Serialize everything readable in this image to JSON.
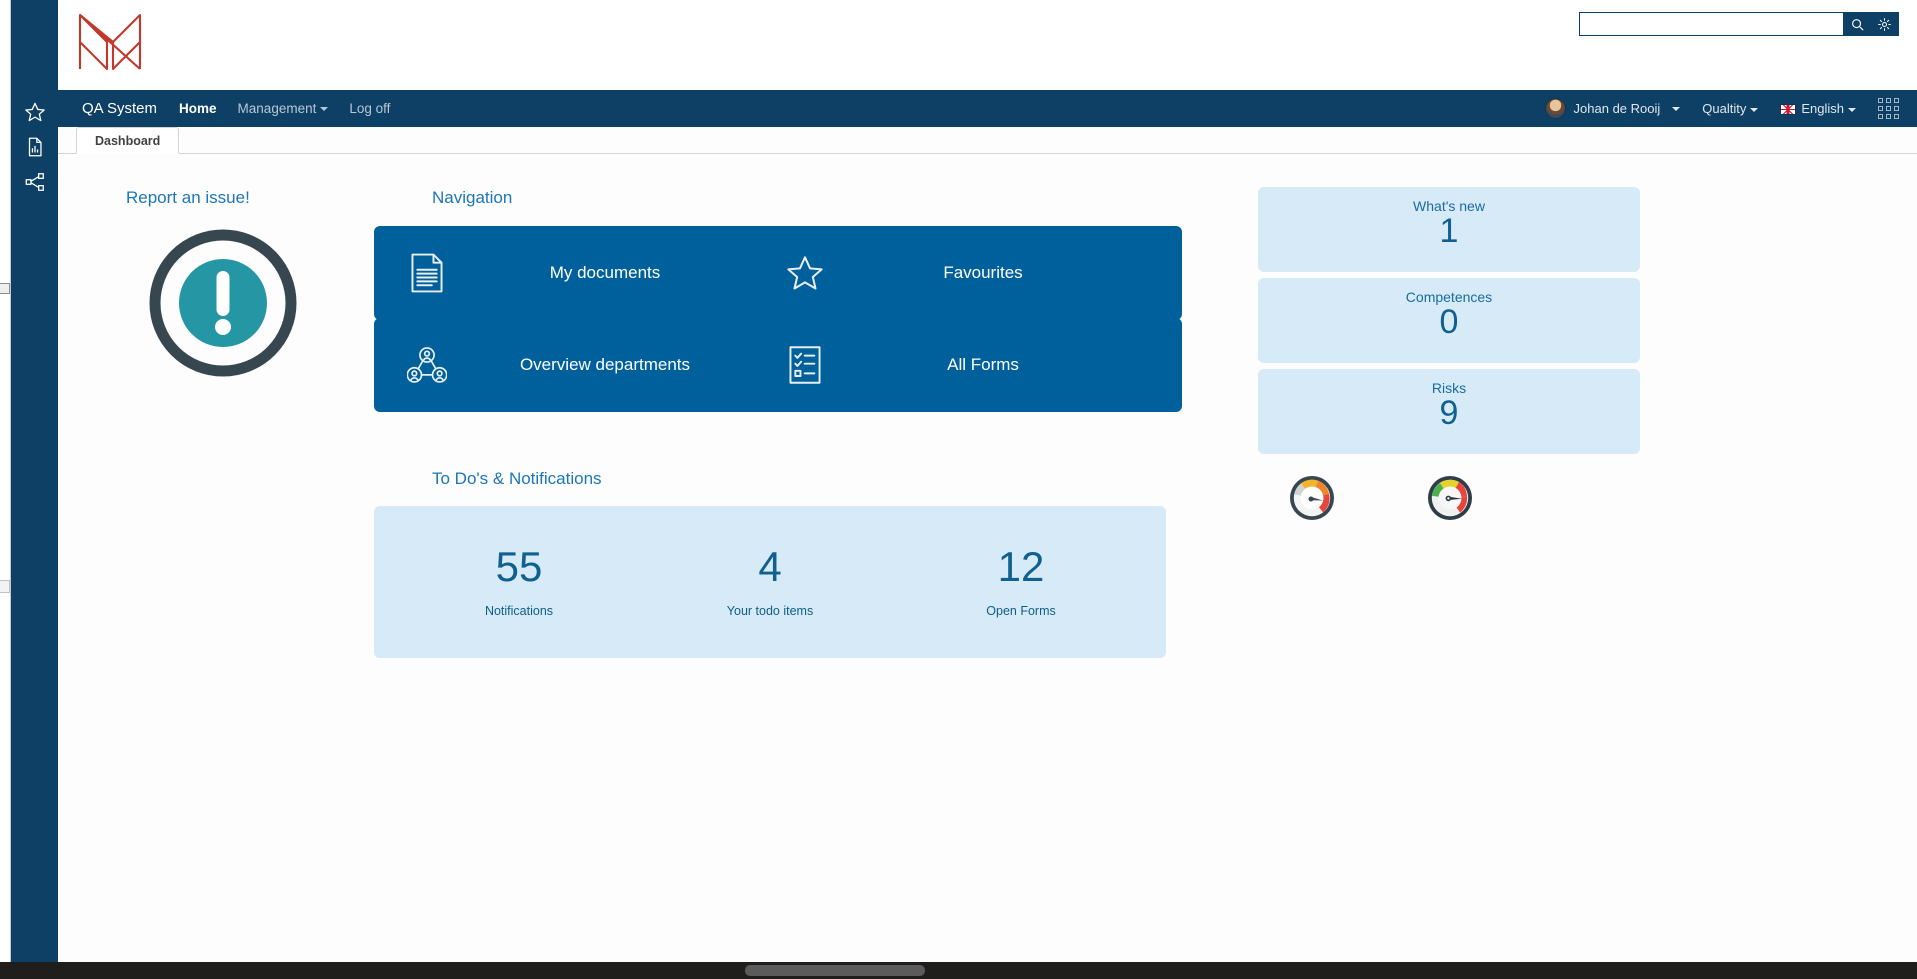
{
  "colors": {
    "navy": "#0e4066",
    "tile_blue": "#00609c",
    "panel_blue": "#d6eaf8",
    "accent_text": "#1c76b8",
    "logo_red": "#c0392b",
    "teal": "#2596a3"
  },
  "search": {
    "value": "",
    "placeholder": "",
    "search_icon": "search-icon",
    "settings_icon": "gear-icon"
  },
  "sidebar": {
    "items": [
      {
        "icon": "star-icon",
        "name": "favourites"
      },
      {
        "icon": "document-chart-icon",
        "name": "reports"
      },
      {
        "icon": "share-nodes-icon",
        "name": "sitemap"
      }
    ]
  },
  "navbar": {
    "brand": "QA System",
    "links": [
      {
        "label": "Home",
        "active": true,
        "caret": false
      },
      {
        "label": "Management",
        "active": false,
        "caret": true
      },
      {
        "label": "Log off",
        "active": false,
        "caret": false
      }
    ],
    "user": "Johan de Rooij",
    "organisation": "Qualtity",
    "language": "English",
    "apps_icon": "grid-apps-icon"
  },
  "tabs": [
    {
      "label": "Dashboard",
      "active": true
    }
  ],
  "report": {
    "title": "Report an issue!",
    "icon": "exclamation-circle-icon"
  },
  "navigation": {
    "title": "Navigation",
    "tiles": [
      {
        "label": "My documents",
        "icon": "document-icon"
      },
      {
        "label": "Favourites",
        "icon": "star-outline-icon"
      },
      {
        "label": "Overview departments",
        "icon": "org-chart-icon"
      },
      {
        "label": "All Forms",
        "icon": "checklist-icon"
      }
    ]
  },
  "todo": {
    "title": "To Do's & Notifications",
    "stats": [
      {
        "value": "55",
        "label": "Notifications"
      },
      {
        "value": "4",
        "label": "Your todo items"
      },
      {
        "value": "12",
        "label": "Open Forms"
      }
    ]
  },
  "panels": [
    {
      "title": "What's new",
      "value": "1"
    },
    {
      "title": "Competences",
      "value": "0"
    },
    {
      "title": "Risks",
      "value": "9"
    }
  ],
  "gauges": [
    {
      "name": "gauge-meter-grey",
      "needle": 35
    },
    {
      "name": "gauge-meter-color",
      "needle": 20
    }
  ]
}
